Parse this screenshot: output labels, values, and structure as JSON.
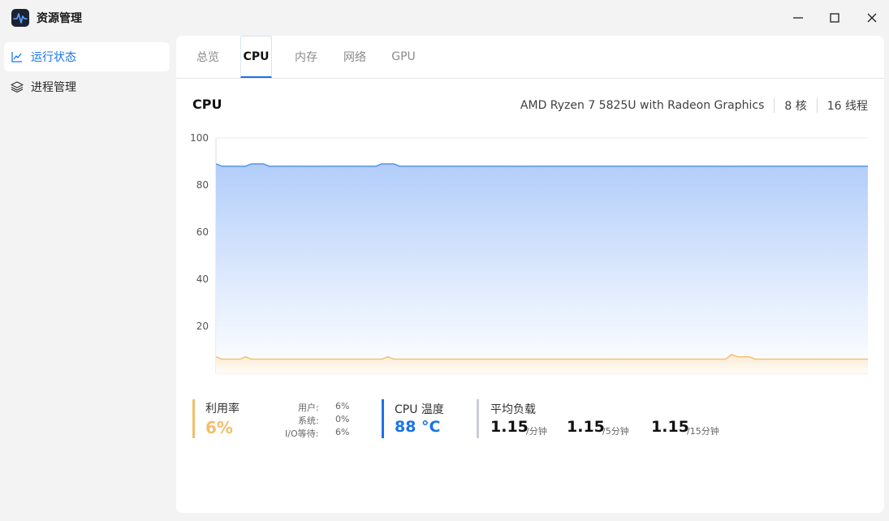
{
  "window": {
    "title": "资源管理"
  },
  "sidebar": {
    "items": [
      {
        "label": "运行状态",
        "icon": "line-chart-icon",
        "active": true
      },
      {
        "label": "进程管理",
        "icon": "layers-icon",
        "active": false
      }
    ]
  },
  "tabs": [
    {
      "label": "总览",
      "active": false
    },
    {
      "label": "CPU",
      "active": true
    },
    {
      "label": "内存",
      "active": false
    },
    {
      "label": "网络",
      "active": false
    },
    {
      "label": "GPU",
      "active": false
    }
  ],
  "cpu": {
    "heading": "CPU",
    "model": "AMD Ryzen 7 5825U with Radeon Graphics",
    "cores": "8 核",
    "threads": "16 线程"
  },
  "chart_data": {
    "type": "area",
    "ylim": [
      0,
      100
    ],
    "yticks": [
      20,
      40,
      60,
      80,
      100
    ],
    "grid": true,
    "series": [
      {
        "color": "#4d8df0",
        "values": [
          89,
          88,
          88,
          88,
          88,
          88,
          89,
          89,
          89,
          88,
          88,
          88,
          88,
          88,
          88,
          88,
          88,
          88,
          88,
          88,
          88,
          88,
          88,
          88,
          88,
          88,
          88,
          88,
          89,
          89,
          89,
          88,
          88,
          88,
          88,
          88,
          88,
          88,
          88,
          88,
          88,
          88,
          88,
          88,
          88,
          88,
          88,
          88,
          88,
          88,
          88,
          88,
          88,
          88,
          88,
          88,
          88,
          88,
          88,
          88,
          88,
          88,
          88,
          88,
          88,
          88,
          88,
          88,
          88,
          88,
          88,
          88,
          88,
          88,
          88,
          88,
          88,
          88,
          88,
          88,
          88,
          88,
          88,
          88,
          88,
          88,
          88,
          88,
          88,
          88,
          88,
          88,
          88,
          88,
          88,
          88,
          88,
          88,
          88,
          88,
          88,
          88,
          88,
          88,
          88,
          88,
          88,
          88,
          88,
          88,
          88
        ]
      },
      {
        "color": "#f3be69",
        "values": [
          7,
          6,
          6,
          6,
          6,
          7,
          6,
          6,
          6,
          6,
          6,
          6,
          6,
          6,
          6,
          6,
          6,
          6,
          6,
          6,
          6,
          6,
          6,
          6,
          6,
          6,
          6,
          6,
          6,
          7,
          6,
          6,
          6,
          6,
          6,
          6,
          6,
          6,
          6,
          6,
          6,
          6,
          6,
          6,
          6,
          6,
          6,
          6,
          6,
          6,
          6,
          6,
          6,
          6,
          6,
          6,
          6,
          6,
          6,
          6,
          6,
          6,
          6,
          6,
          6,
          6,
          6,
          6,
          6,
          6,
          6,
          6,
          6,
          6,
          6,
          6,
          6,
          6,
          6,
          6,
          6,
          6,
          6,
          6,
          6,
          6,
          6,
          8,
          7,
          7,
          7,
          6,
          6,
          6,
          6,
          6,
          6,
          6,
          6,
          6,
          6,
          6,
          6,
          6,
          6,
          6,
          6,
          6,
          6,
          6,
          6
        ]
      }
    ]
  },
  "stats": {
    "utilization": {
      "label": "利用率",
      "value": "6%",
      "user_label": "用户:",
      "user_value": "6%",
      "system_label": "系统:",
      "system_value": "0%",
      "io_label": "I/O等待:",
      "io_value": "6%"
    },
    "temperature": {
      "label": "CPU 温度",
      "value": "88 °C"
    },
    "load": {
      "label": "平均负载",
      "items": [
        {
          "value": "1.15",
          "unit": "/分钟"
        },
        {
          "value": "1.15",
          "unit": "/5分钟"
        },
        {
          "value": "1.15",
          "unit": "/15分钟"
        }
      ]
    }
  },
  "colors": {
    "accent": "#1a73e8",
    "utilization": "#f3be69",
    "temperature": "#1a73e8",
    "load_divider": "#c9ced6"
  }
}
